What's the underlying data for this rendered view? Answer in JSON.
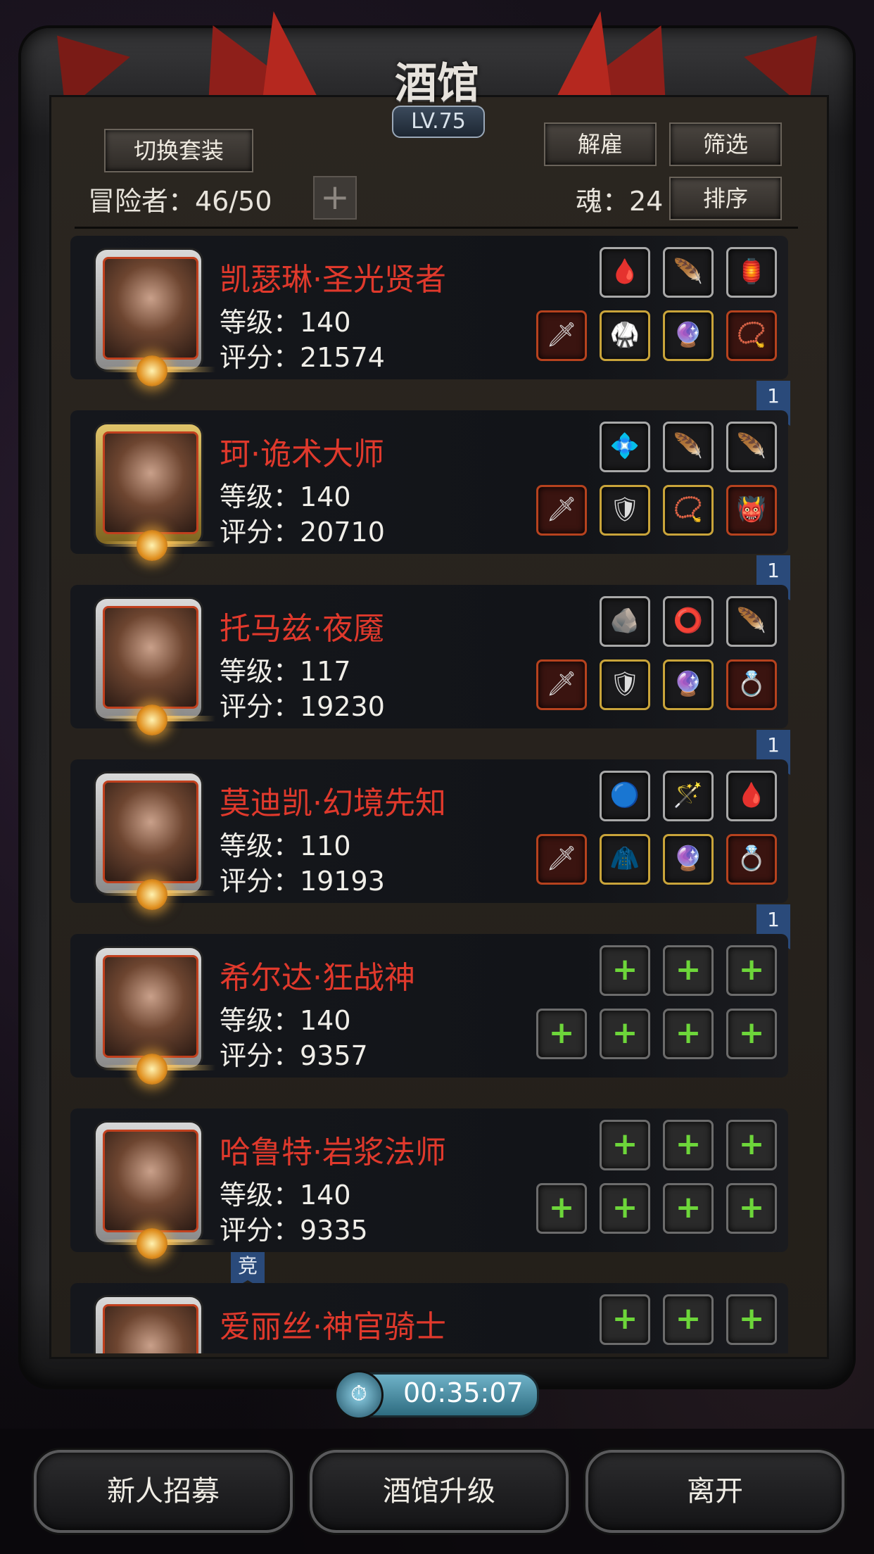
{
  "header": {
    "title": "酒馆",
    "level": "LV.75"
  },
  "toolbar": {
    "switch_outfit": "切换套装",
    "dismiss": "解雇",
    "filter": "筛选",
    "sort": "排序",
    "adventurers": "冒险者：46/50",
    "add": "+",
    "soul": "魂：24"
  },
  "heroes": [
    {
      "name": "凯瑟琳·圣光贤者",
      "level": "等级：140",
      "score": "评分：21574",
      "ribbon": "1",
      "top_slots": [
        "🩸",
        "🪶",
        "🏮"
      ],
      "bottom_slots": [
        "🗡",
        "🥋",
        "🔮",
        "📿"
      ]
    },
    {
      "name": "珂·诡术大师",
      "level": "等级：140",
      "score": "评分：20710",
      "ribbon": "1",
      "top_slots": [
        "💠",
        "🪶",
        "🪶"
      ],
      "bottom_slots": [
        "🗡",
        "🛡",
        "📿",
        "👹"
      ]
    },
    {
      "name": "托马兹·夜魇",
      "level": "等级：117",
      "score": "评分：19230",
      "ribbon": "1",
      "top_slots": [
        "🪨",
        "⭕",
        "🪶"
      ],
      "bottom_slots": [
        "🗡",
        "🛡",
        "🔮",
        "💍"
      ]
    },
    {
      "name": "莫迪凯·幻境先知",
      "level": "等级：110",
      "score": "评分：19193",
      "ribbon": "1",
      "top_slots": [
        "🔵",
        "🪄",
        "🩸"
      ],
      "bottom_slots": [
        "🗡",
        "🧥",
        "🔮",
        "💍"
      ]
    },
    {
      "name": "希尔达·狂战神",
      "level": "等级：140",
      "score": "评分：9357",
      "ribbon": "竞",
      "top_slots": [
        "+",
        "+",
        "+"
      ],
      "bottom_slots": [
        "+",
        "+",
        "+",
        "+"
      ]
    },
    {
      "name": "哈鲁特·岩浆法师",
      "level": "等级：140",
      "score": "评分：9335",
      "ribbon": "",
      "top_slots": [
        "+",
        "+",
        "+"
      ],
      "bottom_slots": [
        "+",
        "+",
        "+",
        "+"
      ]
    },
    {
      "name": "爱丽丝·神官骑士",
      "level": "",
      "score": "",
      "ribbon": "",
      "top_slots": [
        "+",
        "+",
        "+"
      ],
      "bottom_slots": []
    }
  ],
  "timer": "00:35:07",
  "bottom_buttons": {
    "recruit": "新人招募",
    "upgrade": "酒馆升级",
    "leave": "离开"
  }
}
